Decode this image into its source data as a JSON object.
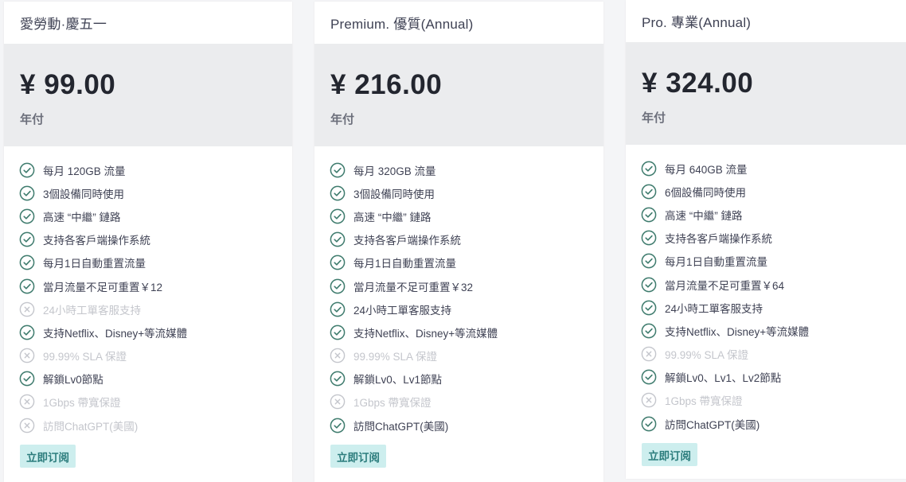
{
  "colors": {
    "check": "#3e7b6d",
    "muted": "#c4c6cc",
    "button_bg": "#cdeeee",
    "button_text": "#2b7c7c",
    "band": "#ebecee"
  },
  "plans": [
    {
      "title": "愛勞動·慶五一",
      "price": "¥ 99.00",
      "period": "年付",
      "button": "立即订阅",
      "features": [
        {
          "text": "每月 120GB 流量",
          "included": true
        },
        {
          "text": "3個設備同時使用",
          "included": true
        },
        {
          "text": "高速 “中繼” 鏈路",
          "included": true
        },
        {
          "text": "支持各客戶端操作系統",
          "included": true
        },
        {
          "text": "每月1日自動重置流量",
          "included": true
        },
        {
          "text": "當月流量不足可重置￥12",
          "included": true
        },
        {
          "text": "24小時工單客服支持",
          "included": false
        },
        {
          "text": "支持Netflix、Disney+等流媒體",
          "included": true
        },
        {
          "text": "99.99% SLA 保證",
          "included": false
        },
        {
          "text": "解鎖Lv0節點",
          "included": true
        },
        {
          "text": "1Gbps 帶寬保證",
          "included": false
        },
        {
          "text": "訪問ChatGPT(美國)",
          "included": false
        }
      ]
    },
    {
      "title": "Premium. 優質(Annual)",
      "price": "¥ 216.00",
      "period": "年付",
      "button": "立即订阅",
      "features": [
        {
          "text": "每月 320GB 流量",
          "included": true
        },
        {
          "text": "3個設備同時使用",
          "included": true
        },
        {
          "text": "高速 “中繼” 鏈路",
          "included": true
        },
        {
          "text": "支持各客戶端操作系統",
          "included": true
        },
        {
          "text": "每月1日自動重置流量",
          "included": true
        },
        {
          "text": "當月流量不足可重置￥32",
          "included": true
        },
        {
          "text": "24小時工單客服支持",
          "included": true
        },
        {
          "text": "支持Netflix、Disney+等流媒體",
          "included": true
        },
        {
          "text": "99.99% SLA 保證",
          "included": false
        },
        {
          "text": "解鎖Lv0、Lv1節點",
          "included": true
        },
        {
          "text": "1Gbps 帶寬保證",
          "included": false
        },
        {
          "text": "訪問ChatGPT(美國)",
          "included": true
        }
      ]
    },
    {
      "title": "Pro. 專業(Annual)",
      "price": "¥ 324.00",
      "period": "年付",
      "button": "立即订阅",
      "features": [
        {
          "text": "每月 640GB 流量",
          "included": true
        },
        {
          "text": "6個設備同時使用",
          "included": true
        },
        {
          "text": "高速 “中繼” 鏈路",
          "included": true
        },
        {
          "text": "支持各客戶端操作系統",
          "included": true
        },
        {
          "text": "每月1日自動重置流量",
          "included": true
        },
        {
          "text": "當月流量不足可重置￥64",
          "included": true
        },
        {
          "text": "24小時工單客服支持",
          "included": true
        },
        {
          "text": "支持Netflix、Disney+等流媒體",
          "included": true
        },
        {
          "text": "99.99% SLA 保證",
          "included": false
        },
        {
          "text": "解鎖Lv0、Lv1、Lv2節點",
          "included": true
        },
        {
          "text": "1Gbps 帶寬保證",
          "included": false
        },
        {
          "text": "訪問ChatGPT(美國)",
          "included": true
        }
      ]
    }
  ]
}
